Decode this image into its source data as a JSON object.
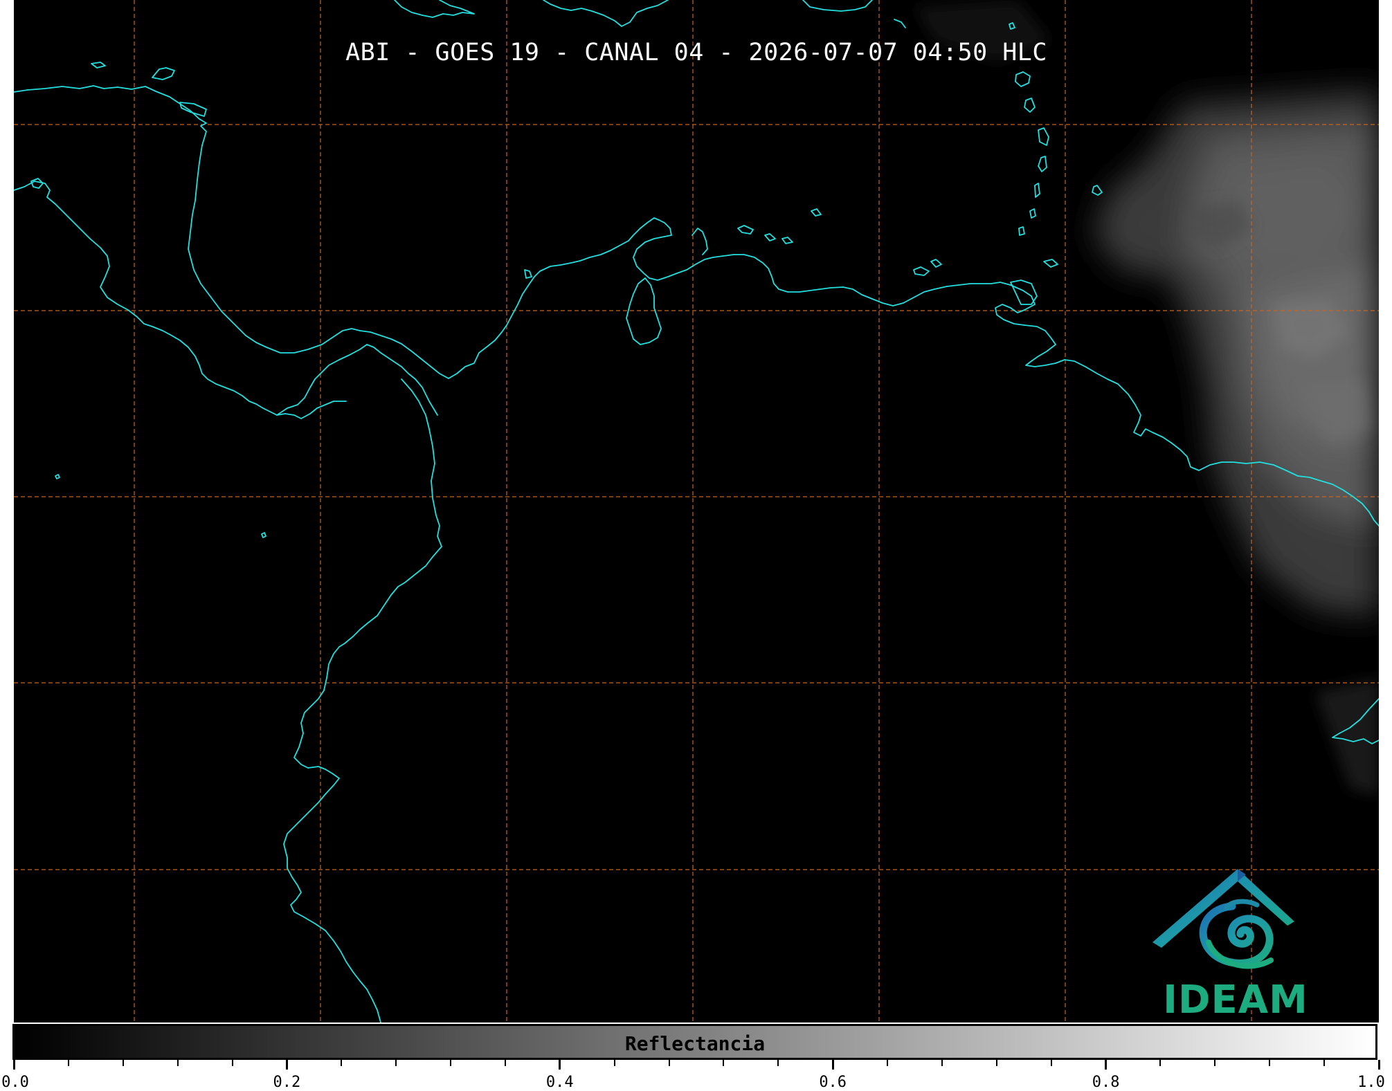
{
  "map": {
    "title": "ABI - GOES 19 - CANAL 04 - 2026-07-07 04:50 HLC",
    "background_color": "#000000",
    "coastline_color": "#22e0e0",
    "gridline_color": "#c8641e",
    "gridlines": "dashed"
  },
  "logo": {
    "text": "IDEAM",
    "text_color": "#1dab80",
    "icon": "ideam-mountain-swirl-icon"
  },
  "colorbar": {
    "label": "Reflectancia",
    "min": 0.0,
    "max": 1.0,
    "colormap": [
      "#000000",
      "#ffffff"
    ],
    "ticks": [
      "0.0",
      "0.2",
      "0.4",
      "0.6",
      "0.8",
      "1.0"
    ]
  }
}
